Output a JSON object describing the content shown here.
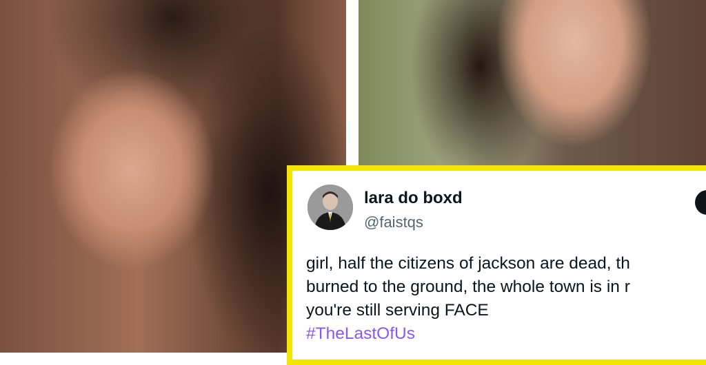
{
  "tweet": {
    "display_name": "lara do boxd",
    "handle": "@faistqs",
    "text_lines": [
      "girl, half the citizens of jackson are dead, th",
      "burned to the ground, the whole town is in r",
      "you're still serving FACE"
    ],
    "hashtag": "#TheLastOfUs",
    "border_color": "#f2e600",
    "hashtag_color": "#8a57f0"
  },
  "images": {
    "left_photo": "portrait-woman-dark-hair",
    "right_photo": "portrait-woman-outdoors"
  }
}
